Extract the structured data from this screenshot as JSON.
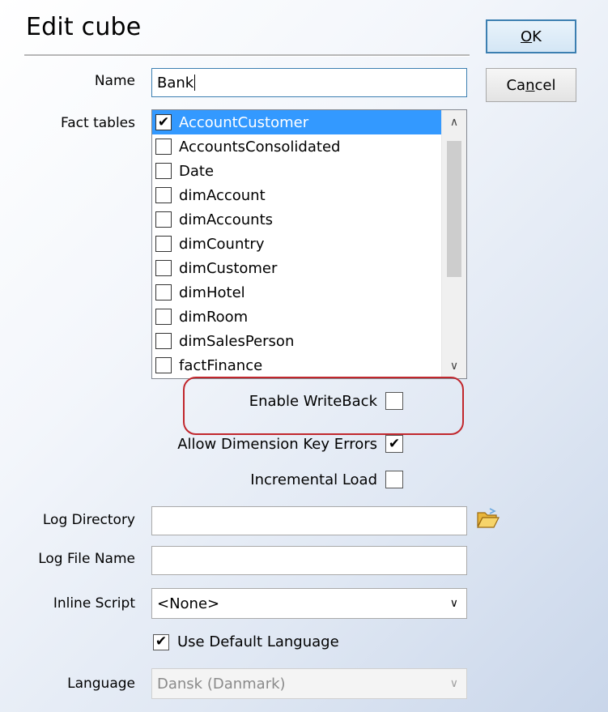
{
  "dialog": {
    "title": "Edit cube"
  },
  "buttons": {
    "ok": {
      "underline": "O",
      "rest": "K"
    },
    "cancel": {
      "pre": "Ca",
      "underline": "n",
      "rest": "cel"
    }
  },
  "fields": {
    "name": {
      "label": "Name",
      "value": "Bank"
    },
    "fact_tables": {
      "label": "Fact tables"
    },
    "log_directory": {
      "label": "Log Directory",
      "value": ""
    },
    "log_file_name": {
      "label": "Log File Name",
      "value": ""
    },
    "inline_script": {
      "label": "Inline Script",
      "value": "<None>"
    },
    "language": {
      "label": "Language",
      "value": "Dansk (Danmark)"
    }
  },
  "fact_tables": [
    {
      "label": "AccountCustomer",
      "checked": true,
      "selected": true
    },
    {
      "label": "AccountsConsolidated",
      "checked": false
    },
    {
      "label": "Date",
      "checked": false
    },
    {
      "label": "dimAccount",
      "checked": false
    },
    {
      "label": "dimAccounts",
      "checked": false
    },
    {
      "label": "dimCountry",
      "checked": false
    },
    {
      "label": "dimCustomer",
      "checked": false
    },
    {
      "label": "dimHotel",
      "checked": false
    },
    {
      "label": "dimRoom",
      "checked": false
    },
    {
      "label": "dimSalesPerson",
      "checked": false
    },
    {
      "label": "factFinance",
      "checked": false
    }
  ],
  "options": {
    "enable_writeback": {
      "label": "Enable WriteBack",
      "checked": false
    },
    "allow_dim_key_errors": {
      "label": "Allow Dimension Key Errors",
      "checked": true
    },
    "incremental_load": {
      "label": "Incremental Load",
      "checked": false
    },
    "use_default_language": {
      "label": "Use Default Language",
      "checked": true
    }
  },
  "icons": {
    "check": "✔",
    "scroll_up": "∧",
    "scroll_down": "∨",
    "dropdown": "∨",
    "folder": "folder-open-icon"
  },
  "colors": {
    "selection": "#3399ff",
    "highlight": "#c1272d",
    "default_button_border": "#3c7fb1"
  }
}
